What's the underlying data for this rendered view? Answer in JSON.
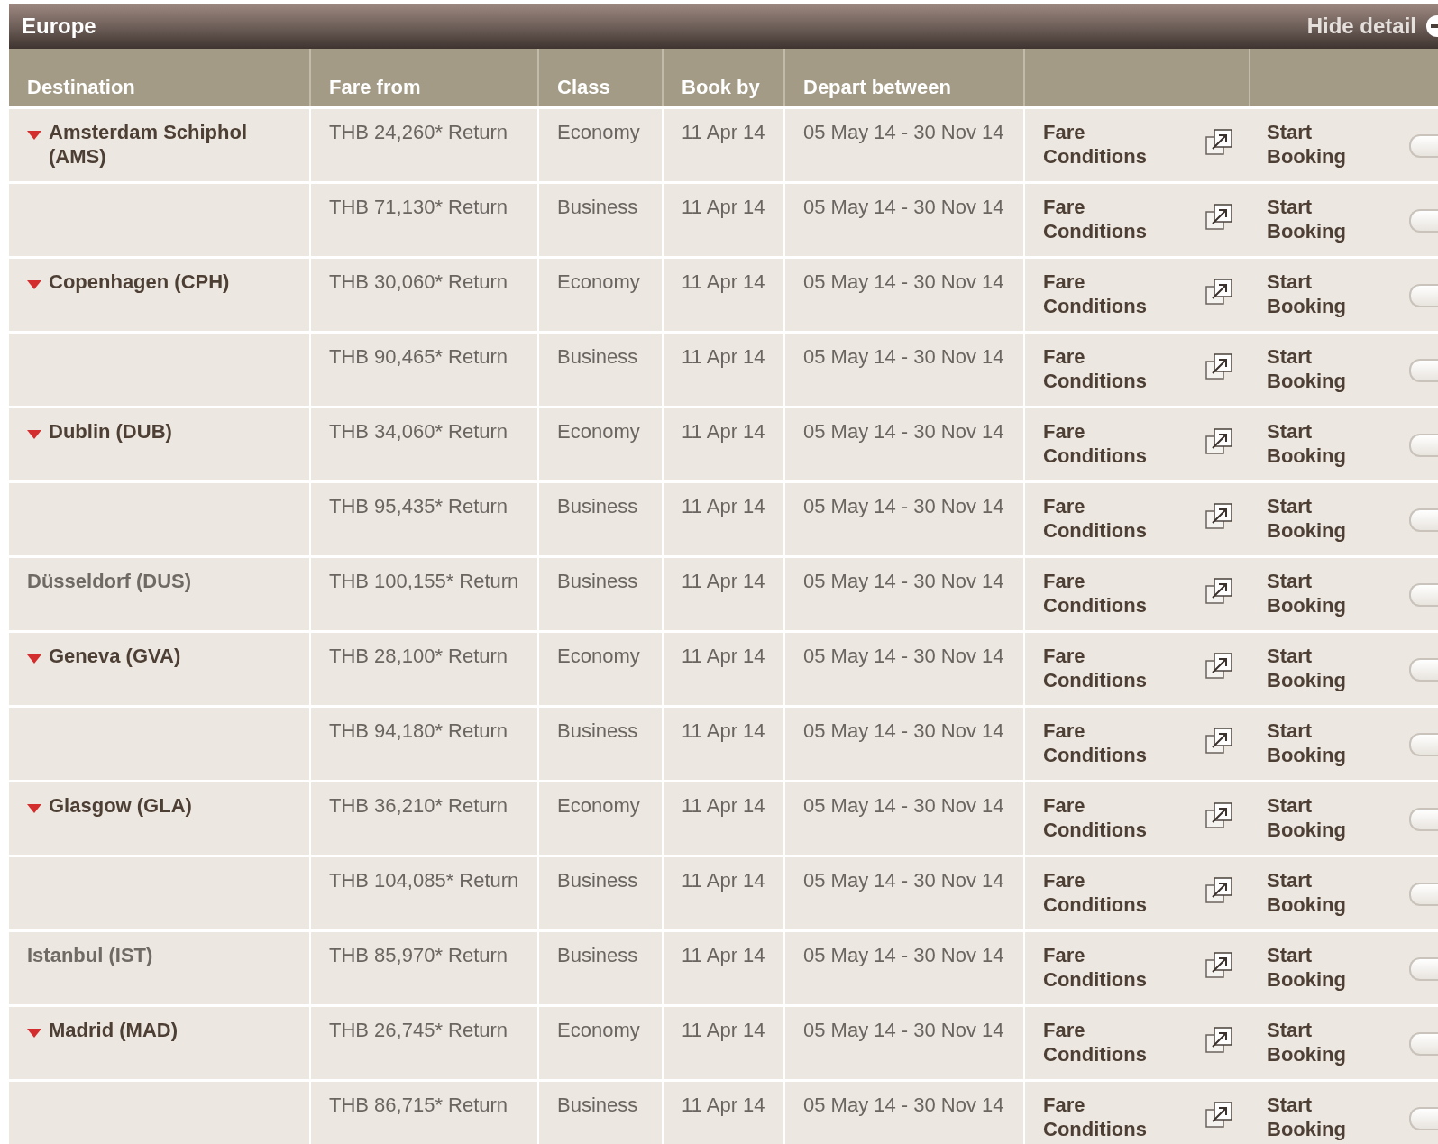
{
  "panel": {
    "title": "Europe",
    "toggle": "Hide detail"
  },
  "columns": [
    "Destination",
    "Fare from",
    "Class",
    "Book by",
    "Depart between"
  ],
  "groups": [
    {
      "destination": "Amsterdam Schiphol (AMS)",
      "expanded": true,
      "fares": [
        {
          "fare": "THB 24,260* Return",
          "class": "Economy",
          "book_by": "11 Apr 14",
          "depart": "05 May 14 - 30 Nov 14",
          "conditions": "Fare Conditions",
          "booking": "Start Booking"
        },
        {
          "fare": "THB 71,130* Return",
          "class": "Business",
          "book_by": "11 Apr 14",
          "depart": "05 May 14 - 30 Nov 14",
          "conditions": "Fare Conditions",
          "booking": "Start Booking"
        }
      ]
    },
    {
      "destination": "Copenhagen (CPH)",
      "expanded": true,
      "fares": [
        {
          "fare": "THB 30,060* Return",
          "class": "Economy",
          "book_by": "11 Apr 14",
          "depart": "05 May 14 - 30 Nov 14",
          "conditions": "Fare Conditions",
          "booking": "Start Booking"
        },
        {
          "fare": "THB 90,465* Return",
          "class": "Business",
          "book_by": "11 Apr 14",
          "depart": "05 May 14 - 30 Nov 14",
          "conditions": "Fare Conditions",
          "booking": "Start Booking"
        }
      ]
    },
    {
      "destination": "Dublin (DUB)",
      "expanded": true,
      "fares": [
        {
          "fare": "THB 34,060* Return",
          "class": "Economy",
          "book_by": "11 Apr 14",
          "depart": "05 May 14 - 30 Nov 14",
          "conditions": "Fare Conditions",
          "booking": "Start Booking"
        },
        {
          "fare": "THB 95,435* Return",
          "class": "Business",
          "book_by": "11 Apr 14",
          "depart": "05 May 14 - 30 Nov 14",
          "conditions": "Fare Conditions",
          "booking": "Start Booking"
        }
      ]
    },
    {
      "destination": "Düsseldorf (DUS)",
      "expanded": false,
      "fares": [
        {
          "fare": "THB 100,155* Return",
          "class": "Business",
          "book_by": "11 Apr 14",
          "depart": "05 May 14 - 30 Nov 14",
          "conditions": "Fare Conditions",
          "booking": "Start Booking"
        }
      ]
    },
    {
      "destination": "Geneva (GVA)",
      "expanded": true,
      "fares": [
        {
          "fare": "THB 28,100* Return",
          "class": "Economy",
          "book_by": "11 Apr 14",
          "depart": "05 May 14 - 30 Nov 14",
          "conditions": "Fare Conditions",
          "booking": "Start Booking"
        },
        {
          "fare": "THB 94,180* Return",
          "class": "Business",
          "book_by": "11 Apr 14",
          "depart": "05 May 14 - 30 Nov 14",
          "conditions": "Fare Conditions",
          "booking": "Start Booking"
        }
      ]
    },
    {
      "destination": "Glasgow (GLA)",
      "expanded": true,
      "fares": [
        {
          "fare": "THB 36,210* Return",
          "class": "Economy",
          "book_by": "11 Apr 14",
          "depart": "05 May 14 - 30 Nov 14",
          "conditions": "Fare Conditions",
          "booking": "Start Booking"
        },
        {
          "fare": "THB 104,085* Return",
          "class": "Business",
          "book_by": "11 Apr 14",
          "depart": "05 May 14 - 30 Nov 14",
          "conditions": "Fare Conditions",
          "booking": "Start Booking"
        }
      ]
    },
    {
      "destination": "Istanbul (IST)",
      "expanded": false,
      "fares": [
        {
          "fare": "THB 85,970* Return",
          "class": "Business",
          "book_by": "11 Apr 14",
          "depart": "05 May 14 - 30 Nov 14",
          "conditions": "Fare Conditions",
          "booking": "Start Booking"
        }
      ]
    },
    {
      "destination": "Madrid (MAD)",
      "expanded": true,
      "fares": [
        {
          "fare": "THB 26,745* Return",
          "class": "Economy",
          "book_by": "11 Apr 14",
          "depart": "05 May 14 - 30 Nov 14",
          "conditions": "Fare Conditions",
          "booking": "Start Booking"
        },
        {
          "fare": "THB 86,715* Return",
          "class": "Business",
          "book_by": "11 Apr 14",
          "depart": "05 May 14 - 30 Nov 14",
          "conditions": "Fare Conditions",
          "booking": "Start Booking"
        }
      ]
    }
  ]
}
